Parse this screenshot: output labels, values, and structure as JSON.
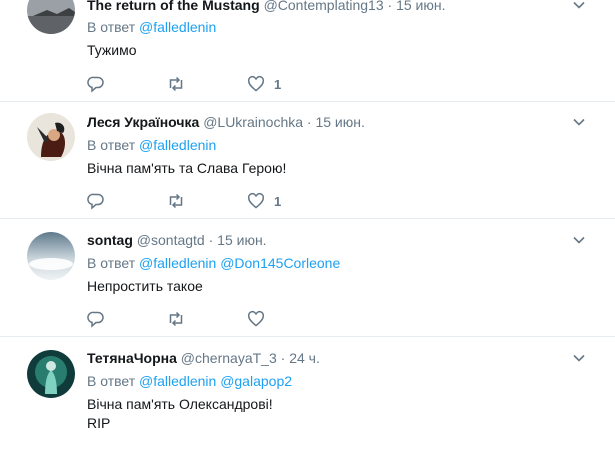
{
  "reply_prefix": "В ответ",
  "tweets": [
    {
      "name": "The return of the Mustang",
      "handle": "@Contemplating13",
      "sep": "·",
      "time": "15 июн.",
      "reply_to": [
        "@falledlenin"
      ],
      "text": [
        "Тужимо"
      ],
      "likes": "1"
    },
    {
      "name": "Леся Україночка",
      "handle": "@LUkrainochka",
      "sep": "·",
      "time": "15 июн.",
      "reply_to": [
        "@falledlenin"
      ],
      "text": [
        "Вічна пам'ять та Слава Герою!"
      ],
      "likes": "1"
    },
    {
      "name": "sontag",
      "handle": "@sontagtd",
      "sep": "·",
      "time": "15 июн.",
      "reply_to": [
        "@falledlenin",
        "@Don145Corleone"
      ],
      "text": [
        "Непростить такое"
      ],
      "likes": ""
    },
    {
      "name": "ТетянаЧорна",
      "handle": "@chernayaT_3",
      "sep": "·",
      "time": "24 ч.",
      "reply_to": [
        "@falledlenin",
        "@galapop2"
      ],
      "text": [
        "Вічна пам'ять Олександрові!",
        "RIP"
      ],
      "likes": ""
    }
  ],
  "icons": {
    "reply": "reply-icon",
    "retweet": "retweet-icon",
    "like": "heart-icon",
    "more": "chevron-down-icon"
  },
  "colors": {
    "link": "#1da1f2",
    "muted": "#657786",
    "divider": "#e6ecf0"
  }
}
